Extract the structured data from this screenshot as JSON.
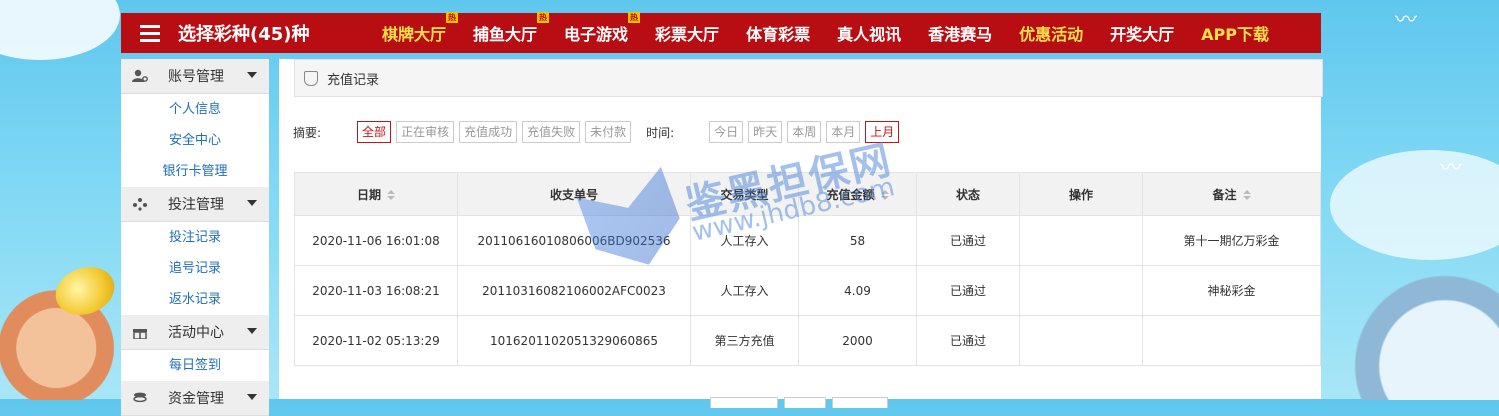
{
  "header": {
    "brand": "选择彩种(45)种",
    "nav": [
      {
        "label": "棋牌大厅",
        "hot": "热",
        "gold": true
      },
      {
        "label": "捕鱼大厅",
        "hot": "热",
        "gold": false
      },
      {
        "label": "电子游戏",
        "hot": "热",
        "gold": false
      },
      {
        "label": "彩票大厅",
        "gold": false
      },
      {
        "label": "体育彩票",
        "gold": false
      },
      {
        "label": "真人视讯",
        "gold": false
      },
      {
        "label": "香港赛马",
        "gold": false
      },
      {
        "label": "优惠活动",
        "gold": true
      },
      {
        "label": "开奖大厅",
        "gold": false
      },
      {
        "label": "APP下载",
        "gold": true
      }
    ]
  },
  "sidebar": {
    "groups": [
      {
        "label": "账号管理",
        "icon": "user-gear-icon",
        "items": [
          "个人信息",
          "安全中心",
          "银行卡管理"
        ]
      },
      {
        "label": "投注管理",
        "icon": "dots-icon",
        "items": [
          "投注记录",
          "追号记录",
          "返水记录"
        ]
      },
      {
        "label": "活动中心",
        "icon": "gift-icon",
        "items": [
          "每日签到"
        ]
      },
      {
        "label": "资金管理",
        "icon": "coins-icon",
        "items": []
      }
    ]
  },
  "breadcrumb": {
    "title": "充值记录",
    "icon": "shield-icon"
  },
  "filters": {
    "summary_label": "摘要:",
    "status_options": [
      "全部",
      "正在审核",
      "充值成功",
      "充值失败",
      "未付款"
    ],
    "status_active": "全部",
    "time_label": "时间:",
    "time_options": [
      "今日",
      "昨天",
      "本周",
      "本月",
      "上月"
    ],
    "time_active": "上月"
  },
  "table": {
    "columns": [
      "日期",
      "收支单号",
      "交易类型",
      "充值金额",
      "状态",
      "操作",
      "备注"
    ],
    "rows": [
      [
        "2020-11-06 16:01:08",
        "20110616010806006BD902536",
        "人工存入",
        "58",
        "已通过",
        "",
        "第十一期亿万彩金"
      ],
      [
        "2020-11-03 16:08:21",
        "20110316082106002AFC0023",
        "人工存入",
        "4.09",
        "已通过",
        "",
        "神秘彩金"
      ],
      [
        "2020-11-02 05:13:29",
        "1016201102051329060865",
        "第三方充值",
        "2000",
        "已通过",
        "",
        ""
      ]
    ]
  },
  "watermark": {
    "text": "鉴黑担保网",
    "url": "www.jhdb8.com"
  },
  "colors": {
    "nav_bg": "#b80d12",
    "gold": "#ffe04a",
    "active": "#c4141b",
    "link": "#1e6fb8"
  }
}
